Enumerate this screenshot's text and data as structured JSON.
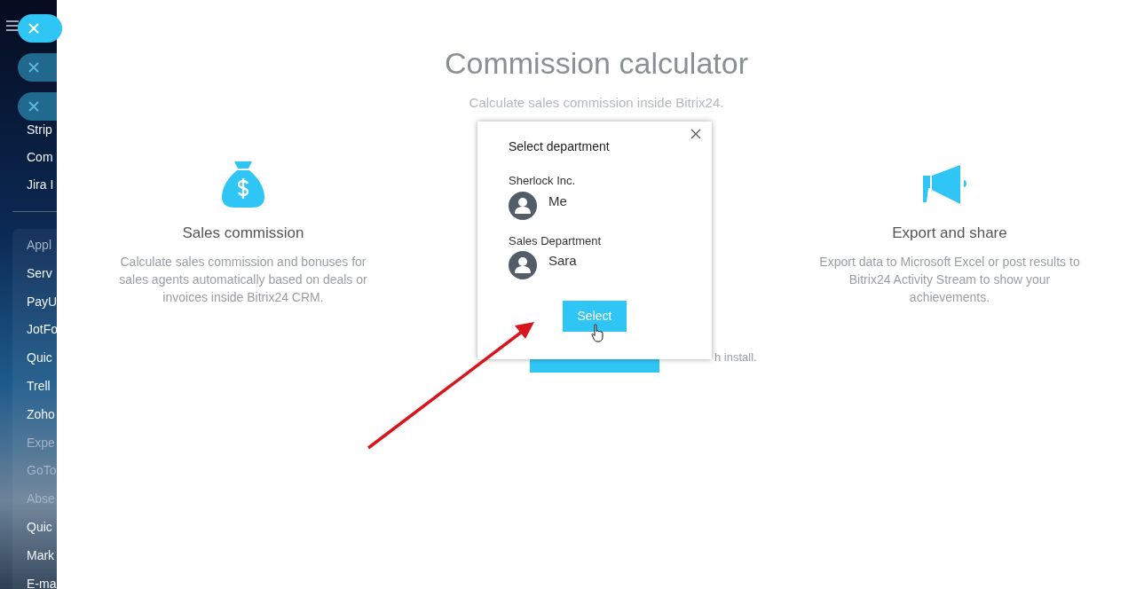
{
  "sidebar": {
    "items": [
      {
        "label": "Strip",
        "disabled": false
      },
      {
        "label": "Com",
        "disabled": false
      },
      {
        "label": "Jira I",
        "disabled": false
      }
    ],
    "apps": [
      {
        "label": "Appl",
        "disabled": true
      },
      {
        "label": "Serv",
        "disabled": false
      },
      {
        "label": "PayU",
        "disabled": false
      },
      {
        "label": "JotFo",
        "disabled": false
      },
      {
        "label": "Quic",
        "disabled": false
      },
      {
        "label": "Trell",
        "disabled": false
      },
      {
        "label": "Zoho",
        "disabled": false
      },
      {
        "label": "Expe",
        "disabled": true
      },
      {
        "label": "GoTo",
        "disabled": true
      },
      {
        "label": "Abse",
        "disabled": true
      },
      {
        "label": "Quic",
        "disabled": false
      },
      {
        "label": "Mark",
        "disabled": false
      },
      {
        "label": "E-ma",
        "disabled": false
      }
    ]
  },
  "page": {
    "title": "Commission calculator",
    "subtitle": "Calculate sales commission inside Bitrix24.",
    "features": [
      {
        "kind": "money",
        "title": "Sales commission",
        "text": "Calculate sales commission and bonuses for sales agents automatically based on deals or invoices inside Bitrix24 CRM."
      },
      {
        "kind": "megaphone",
        "title": "Export and share",
        "text": "Export data to Microsoft Excel or post results to Bitrix24 Activity Stream to show your achievements."
      }
    ],
    "install_note": "h install."
  },
  "dialog": {
    "title": "Select department",
    "groups": [
      {
        "department": "Sherlock Inc.",
        "member": "Me"
      },
      {
        "department": "Sales Department",
        "member": "Sara"
      }
    ],
    "button": "Select"
  }
}
